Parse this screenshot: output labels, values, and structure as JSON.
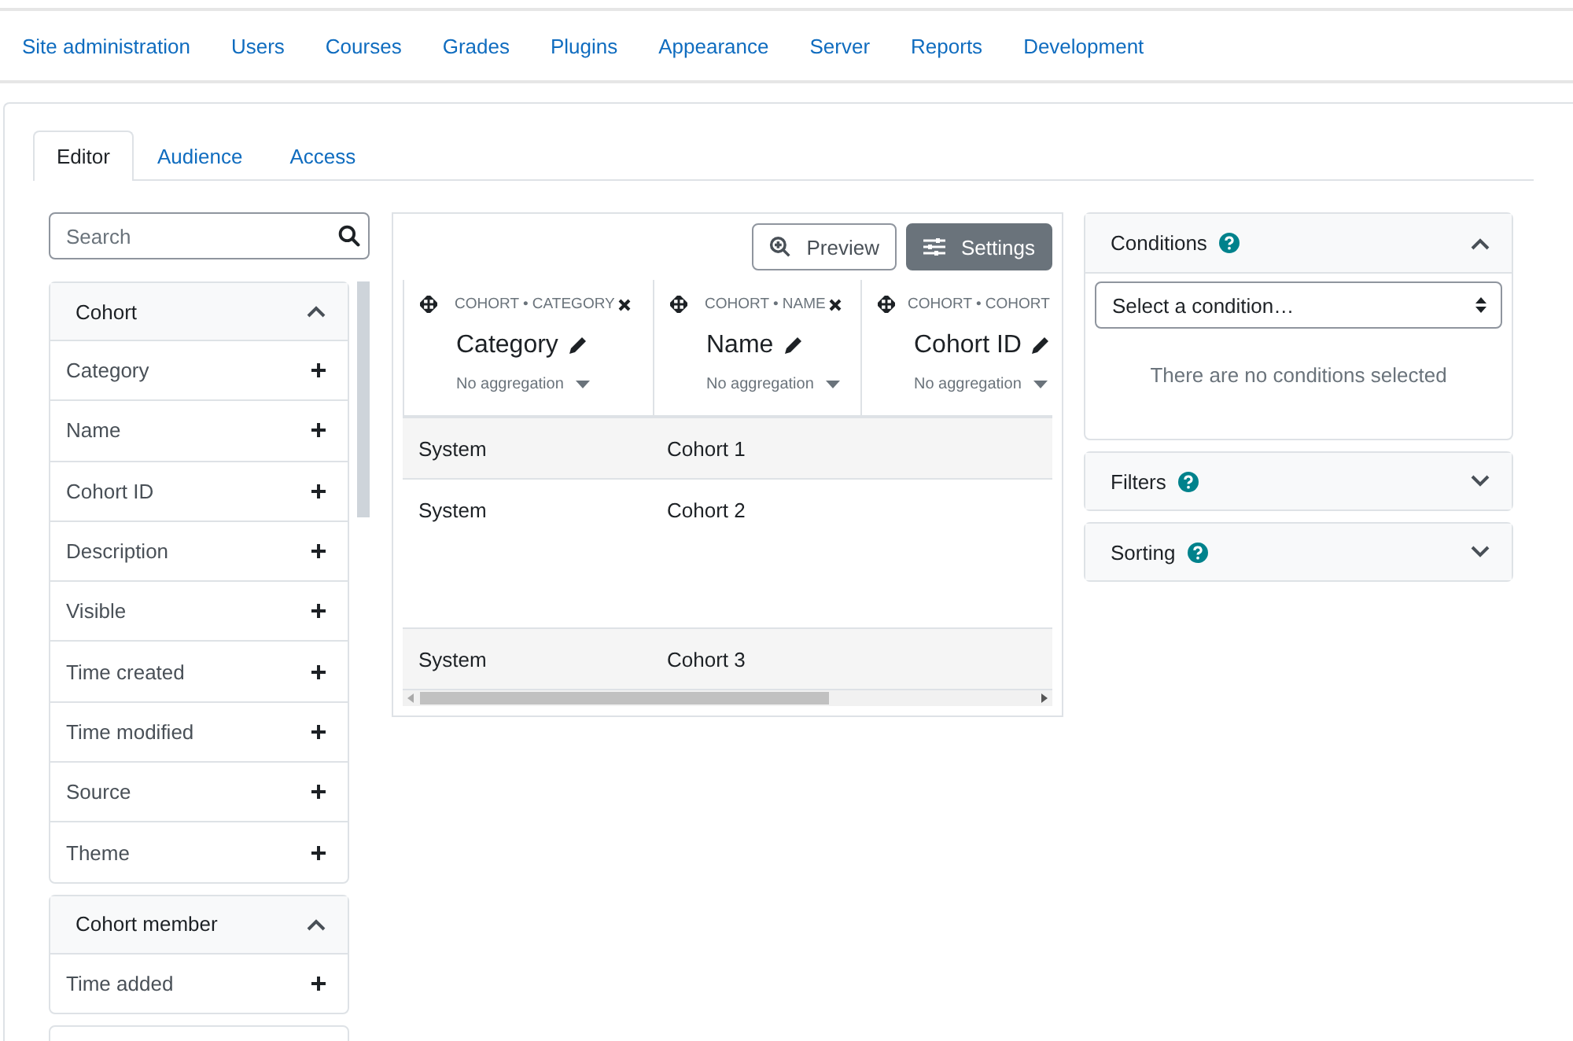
{
  "nav": [
    "Site administration",
    "Users",
    "Courses",
    "Grades",
    "Plugins",
    "Appearance",
    "Server",
    "Reports",
    "Development"
  ],
  "tabs": [
    {
      "label": "Editor",
      "selected": true
    },
    {
      "label": "Audience",
      "selected": false
    },
    {
      "label": "Access",
      "selected": false
    }
  ],
  "sidebar": {
    "search": {
      "placeholder": "Search"
    },
    "groups": [
      {
        "title": "Cohort",
        "expanded": true,
        "items": [
          "Category",
          "Name",
          "Cohort ID",
          "Description",
          "Visible",
          "Time created",
          "Time modified",
          "Source",
          "Theme"
        ]
      },
      {
        "title": "Cohort member",
        "expanded": true,
        "items": [
          "Time added"
        ]
      }
    ]
  },
  "toolbar": {
    "preview": "Preview",
    "settings": "Settings"
  },
  "table": {
    "columns": [
      {
        "source": "COHORT • CATEGORY",
        "removable": true,
        "title": "Category",
        "aggregation": "No aggregation"
      },
      {
        "source": "COHORT • NAME",
        "removable": true,
        "title": "Name",
        "aggregation": "No aggregation"
      },
      {
        "source": "COHORT • COHORT",
        "removable": false,
        "title": "Cohort ID",
        "aggregation": "No aggregation"
      }
    ],
    "rows": [
      {
        "cells": [
          "System",
          "Cohort 1"
        ]
      },
      {
        "cells": [
          "System",
          "Cohort 2"
        ]
      },
      {
        "cells": [
          "System",
          "Cohort 3"
        ]
      }
    ]
  },
  "panels": [
    {
      "title": "Conditions",
      "expanded": true,
      "select": {
        "placeholder": "Select a condition…"
      },
      "empty_text": "There are no conditions selected"
    },
    {
      "title": "Filters",
      "expanded": false
    },
    {
      "title": "Sorting",
      "expanded": false
    }
  ]
}
